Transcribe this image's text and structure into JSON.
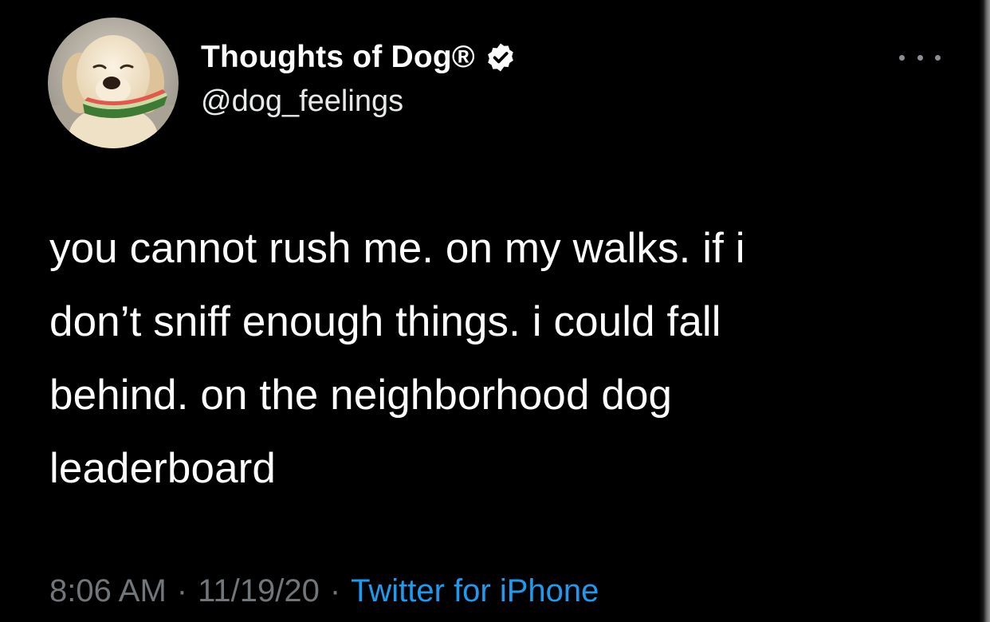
{
  "user": {
    "display_name": "Thoughts of Dog®",
    "handle": "@dog_feelings",
    "verified": true,
    "verified_icon": "verified-badge-icon",
    "avatar": "dog-holding-watermelon-avatar"
  },
  "menu": {
    "icon": "more-options-icon"
  },
  "tweet": {
    "lines": [
      "you cannot rush me. on my walks. if i",
      "don’t sniff enough things. i could fall",
      "behind. on the neighborhood dog",
      "leaderboard"
    ]
  },
  "meta": {
    "time": "8:06 AM",
    "separator": "·",
    "date": "11/19/20",
    "source": "Twitter for iPhone"
  },
  "colors": {
    "background": "#000000",
    "text": "#ffffff",
    "muted": "#71767b",
    "link": "#1d9bf0"
  }
}
